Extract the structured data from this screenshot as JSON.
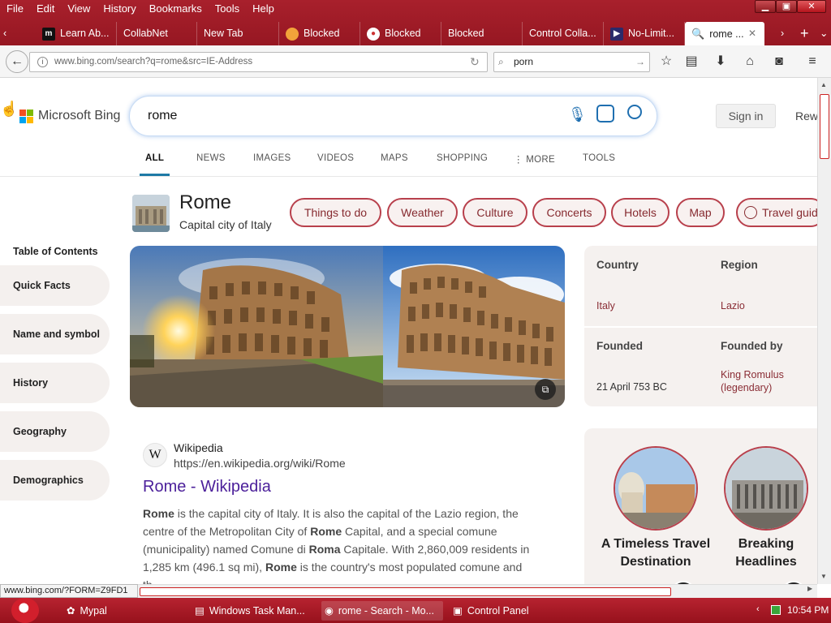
{
  "menu": [
    "File",
    "Edit",
    "View",
    "History",
    "Bookmarks",
    "Tools",
    "Help"
  ],
  "window_controls": {
    "minimize": "▁",
    "maximize": "▣",
    "close": "✕"
  },
  "tabs": [
    {
      "label": "Learn Ab...",
      "icon": "m"
    },
    {
      "label": "CollabNet",
      "icon": ""
    },
    {
      "label": "New Tab",
      "icon": ""
    },
    {
      "label": "Blocked",
      "icon": "firefox"
    },
    {
      "label": "Blocked",
      "icon": "chrome"
    },
    {
      "label": "Blocked",
      "icon": ""
    },
    {
      "label": "Control Colla...",
      "icon": ""
    },
    {
      "label": "No-Limit...",
      "icon": "n"
    },
    {
      "label": "rome ...",
      "icon": "search",
      "close": "✕"
    }
  ],
  "nav": {
    "url": "www.bing.com/search?q=rome&src=IE-Address",
    "search_value": "porn"
  },
  "bing": {
    "logo_text": "Microsoft Bing",
    "query": "rome",
    "sign_in": "Sign in",
    "rewards": "Rew",
    "scopes": [
      "ALL",
      "NEWS",
      "IMAGES",
      "VIDEOS",
      "MAPS",
      "SHOPPING",
      "MORE",
      "TOOLS"
    ],
    "entity": {
      "title": "Rome",
      "subtitle": "Capital city of Italy"
    },
    "pills": [
      "Things to do",
      "Weather",
      "Culture",
      "Concerts",
      "Hotels",
      "Map",
      "Travel guid"
    ],
    "toc": {
      "heading": "Table of Contents",
      "items": [
        "Quick Facts",
        "Name and symbol",
        "History",
        "Geography",
        "Demographics"
      ]
    },
    "facts": {
      "country_label": "Country",
      "country_value": "Italy",
      "region_label": "Region",
      "region_value": "Lazio",
      "founded_label": "Founded",
      "founded_value": "21 April 753 BC",
      "founded_by_label": "Founded by",
      "founded_by_value": "King Romulus (legendary)"
    },
    "wiki": {
      "icon_letter": "W",
      "site": "Wikipedia",
      "url": "https://en.wikipedia.org/wiki/Rome",
      "title": "Rome - Wikipedia"
    },
    "videos": [
      {
        "title": "A Timeless Travel Destination"
      },
      {
        "title": "Breaking Headlines"
      }
    ]
  },
  "status_url": "www.bing.com/?FORM=Z9FD1",
  "taskbar": {
    "items": [
      "Mypal",
      "Windows Task Man...",
      "rome - Search - Mo...",
      "Control Panel"
    ],
    "clock": "10:54 PM"
  },
  "colors": {
    "accent": "#b8404c",
    "chrome": "#a8202c",
    "link": "#4b1f9a"
  }
}
